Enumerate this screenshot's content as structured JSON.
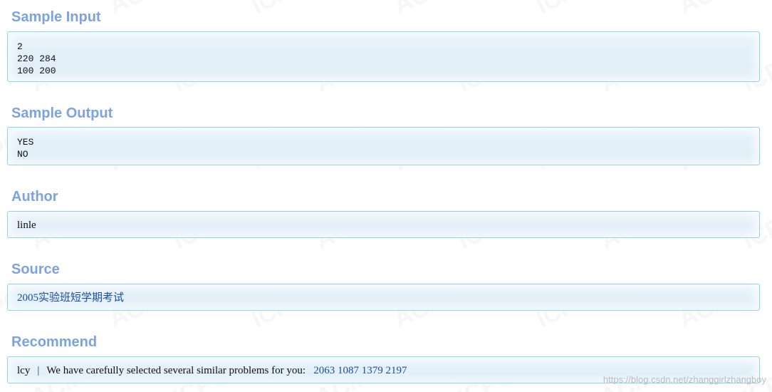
{
  "sample_input": {
    "title": "Sample Input",
    "lines": [
      "2",
      "220 284",
      "100 200"
    ]
  },
  "sample_output": {
    "title": "Sample Output",
    "lines": [
      "YES",
      "NO"
    ]
  },
  "author": {
    "title": "Author",
    "value": "linle"
  },
  "source": {
    "title": "Source",
    "link_text": "2005实验班短学期考试"
  },
  "recommend": {
    "title": "Recommend",
    "user": "lcy",
    "separator": "|",
    "text": "We have carefully selected several similar problems for you:",
    "problems": [
      "2063",
      "1087",
      "1379",
      "2197"
    ]
  },
  "background_watermark": {
    "text_a": "ICPC",
    "text_b": "ACM"
  },
  "blog_watermark": "https://blog.csdn.net/zhanggirlzhangboy",
  "colors": {
    "title": "#7ca3e0",
    "border": "#8fd3ef",
    "box_bg": "#e2eff8",
    "link": "#1a4ea6"
  }
}
